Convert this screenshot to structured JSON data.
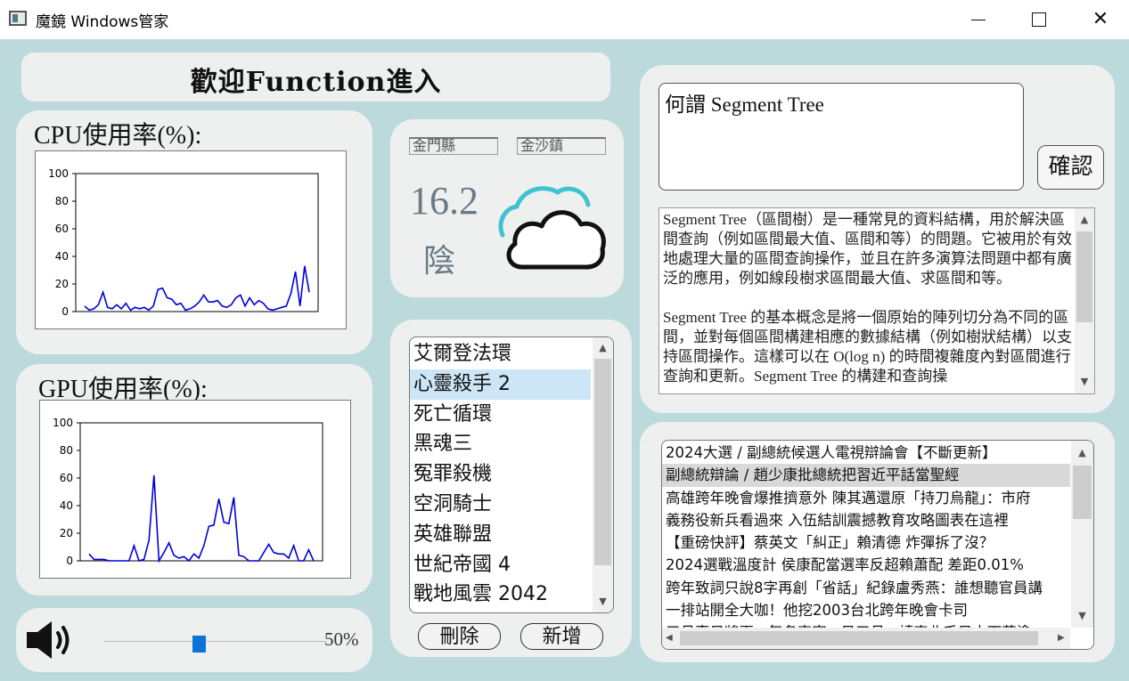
{
  "window": {
    "title": "魔鏡 Windows管家",
    "controls": {
      "minimize_icon": "minimize-icon",
      "maximize_icon": "maximize-icon",
      "close_glyph": "✕"
    }
  },
  "welcome": {
    "text": "歡迎Function進入"
  },
  "cpu": {
    "title": "CPU使用率(%):",
    "chart_data": {
      "type": "line",
      "series": [
        {
          "values": [
            4,
            1,
            2,
            5,
            14,
            3,
            2,
            5,
            2,
            6,
            1,
            3,
            2,
            3,
            1,
            4,
            16,
            17,
            10,
            9,
            5,
            6,
            1,
            2,
            4,
            7,
            12,
            7,
            7,
            8,
            4,
            3,
            5,
            10,
            12,
            4,
            10,
            5,
            8,
            6,
            2,
            1,
            2,
            3,
            4,
            13,
            29,
            4,
            33,
            14
          ]
        }
      ],
      "ylim": [
        0,
        100
      ],
      "yticks": [
        0,
        20,
        40,
        60,
        80,
        100
      ],
      "color": "#0000dd"
    }
  },
  "gpu": {
    "title": "GPU使用率(%):",
    "chart_data": {
      "type": "line",
      "series": [
        {
          "values": [
            5,
            1,
            1,
            1,
            0,
            0,
            0,
            0,
            0,
            11,
            0,
            1,
            15,
            62,
            0,
            6,
            13,
            4,
            2,
            3,
            0,
            5,
            2,
            11,
            25,
            26,
            45,
            28,
            27,
            46,
            4,
            3,
            0,
            0,
            0,
            6,
            12,
            6,
            5,
            5,
            2,
            11,
            0,
            0,
            8,
            0
          ]
        }
      ],
      "ylim": [
        0,
        100
      ],
      "yticks": [
        0,
        20,
        40,
        60,
        80,
        100
      ],
      "color": "#0000dd"
    }
  },
  "volume": {
    "icon": "speaker-icon",
    "percent_label": "50%",
    "level": 0.5
  },
  "weather": {
    "county": "金門縣",
    "town": "金沙鎮",
    "temperature": "16.2",
    "condition": "陰",
    "icon": "cloud-icon"
  },
  "games": {
    "items": [
      "艾爾登法環",
      "心靈殺手 2",
      "死亡循環",
      "黑魂三",
      "冤罪殺機",
      "空洞騎士",
      "英雄聯盟",
      "世紀帝國 4",
      "戰地風雲 2042"
    ],
    "selected_index": 1,
    "delete_label": "刪除",
    "add_label": "新增"
  },
  "qa": {
    "question": "何謂 Segment Tree",
    "confirm_label": "確認",
    "answer": "Segment Tree（區間樹）是一種常見的資料結構，用於解決區間查詢（例如區間最大值、區間和等）的問題。它被用於有效地處理大量的區間查詢操作，並且在許多演算法問題中都有廣泛的應用，例如線段樹求區間最大值、求區間和等。\n\nSegment Tree 的基本概念是將一個原始的陣列切分為不同的區間，並對每個區間構建相應的數據結構（例如樹狀結構）以支持區間操作。這樣可以在 O(log n) 的時間複雜度內對區間進行查詢和更新。Segment Tree 的構建和查詢操"
  },
  "news": {
    "items": [
      "2024大選 / 副總統候選人電視辯論會【不斷更新】",
      "副總統辯論 / 趙少康批總統把習近平話當聖經",
      "高雄跨年晚會爆推擠意外 陳其邁還原「持刀烏龍」：市府",
      "義務役新兵看過來 入伍結訓震撼教育攻略圖表在這裡",
      "【重磅快評】蔡英文「糾正」賴清德 炸彈拆了沒？",
      "2024選戰溫度計 侯康配當選率反超賴蕭配 差距0.01%",
      "跨年致詞只說8字再創「省話」紀錄盧秀燕：誰想聽官員講",
      "一排站開全大咖！他挖2003台北跨年晚會卡司",
      "三月臺日將再...每名專家...日三月...請專北千日中下著塗"
    ],
    "selected_index": 1
  }
}
